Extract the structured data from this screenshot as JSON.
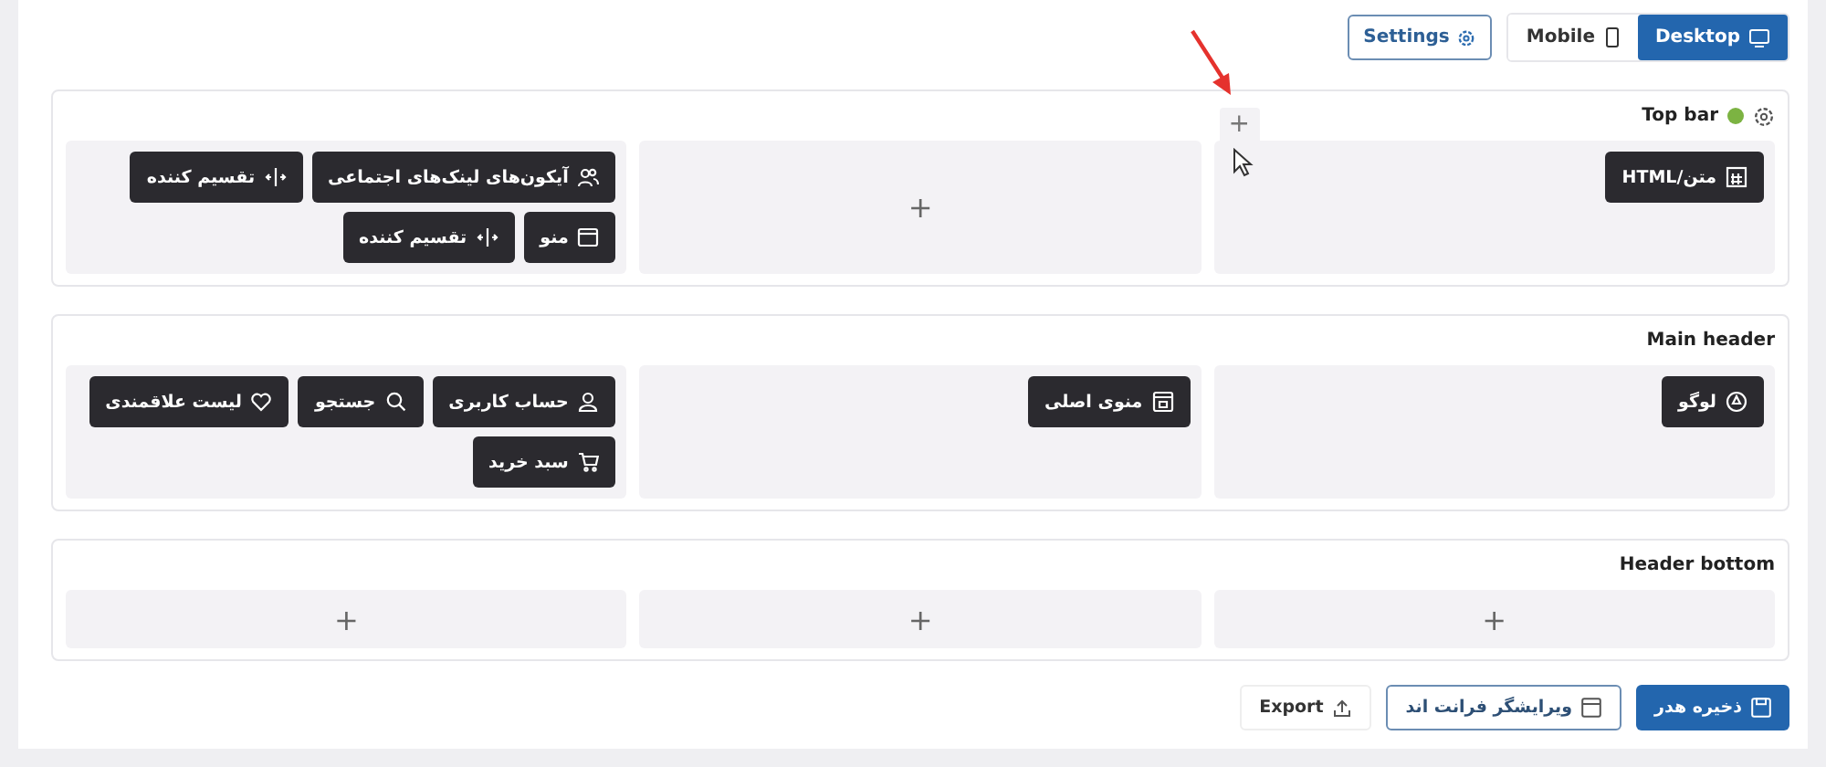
{
  "toolbar": {
    "settings": "Settings",
    "modes": [
      {
        "label": "Desktop",
        "kind": "desktop",
        "selected": true
      },
      {
        "label": "Mobile",
        "kind": "mobile",
        "selected": false
      }
    ]
  },
  "sections": [
    {
      "title": "Top bar",
      "color": "#7cb342",
      "hover_add": "+",
      "columns": [
        {
          "items": [
            {
              "label": "متن/HTML",
              "kind": "html"
            }
          ]
        },
        {
          "add": "+"
        },
        {
          "items": [
            {
              "label": "آیکون‌های لینک‌های اجتماعی",
              "kind": "social"
            },
            {
              "label": "تقسیم کننده",
              "kind": "divider"
            },
            {
              "label": "منو",
              "kind": "menu"
            },
            {
              "label": "تقسیم کننده",
              "kind": "divider"
            }
          ]
        }
      ]
    },
    {
      "title": "Main header",
      "columns": [
        {
          "items": [
            {
              "label": "لوگو",
              "kind": "logo"
            }
          ]
        },
        {
          "items": [
            {
              "label": "منوی اصلی",
              "kind": "main-menu"
            }
          ]
        },
        {
          "items": [
            {
              "label": "حساب کاربری",
              "kind": "account"
            },
            {
              "label": "جستجو",
              "kind": "search"
            },
            {
              "label": "لیست علاقمندی",
              "kind": "wishlist"
            },
            {
              "label": "سبد خرید",
              "kind": "cart"
            }
          ]
        }
      ]
    },
    {
      "title": "Header bottom",
      "columns": [
        {
          "add": "+"
        },
        {
          "add": "+"
        },
        {
          "add": "+"
        }
      ]
    }
  ],
  "footer": [
    {
      "label": "ذخیره هدر",
      "kind": "primary"
    },
    {
      "label": "ویرایشگر فرانت اند",
      "kind": "outline"
    },
    {
      "label": "Export",
      "kind": "plain"
    }
  ]
}
